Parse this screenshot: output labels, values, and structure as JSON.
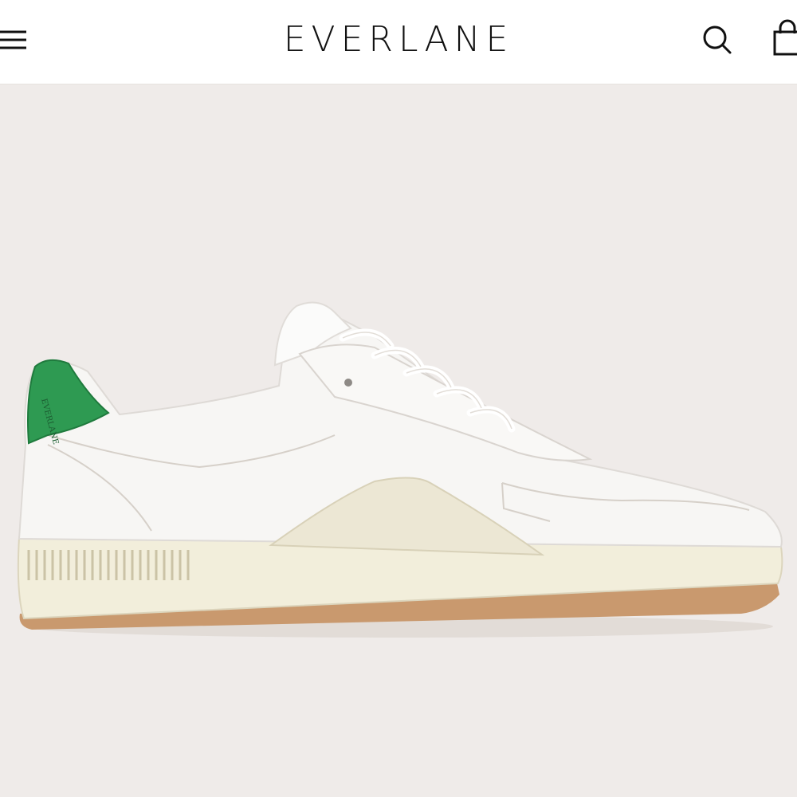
{
  "header": {
    "brand": "EVERLANE",
    "menu_icon": "hamburger-menu-icon",
    "search_icon": "search-icon",
    "bag_icon": "shopping-bag-icon"
  },
  "product_image": {
    "subject": "white leather low-top sneaker with green heel tab",
    "heel_text": "EVERLANE"
  },
  "colors": {
    "background": "#efebe9",
    "header": "#ffffff",
    "text": "#111111",
    "accent_green": "#2e9a52",
    "sole_cream": "#f2eedb",
    "gum_trim": "#c9996e"
  }
}
